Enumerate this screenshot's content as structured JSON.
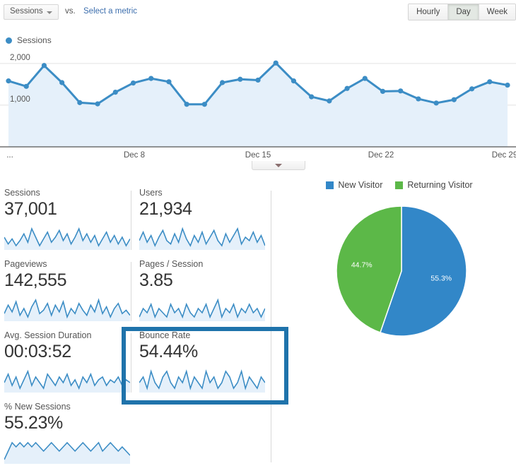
{
  "toolbar": {
    "metric_select_label": "Sessions",
    "vs_label": "vs.",
    "select_metric_link": "Select a metric",
    "caret_icon": "chevron-down-icon",
    "granularity": [
      {
        "label": "Hourly",
        "active": false
      },
      {
        "label": "Day",
        "active": true
      },
      {
        "label": "Week",
        "active": false
      }
    ]
  },
  "chart_legend": {
    "label": "Sessions",
    "color": "#3c8dc5"
  },
  "chart_data": {
    "type": "line",
    "title": "Sessions",
    "xlabel": "",
    "ylabel": "Sessions",
    "ylim": [
      0,
      2200
    ],
    "yticks": [
      1000,
      2000
    ],
    "ytick_labels": [
      "1,000",
      "2,000"
    ],
    "grid": true,
    "legend_position": "top-left",
    "xtick_labels": [
      "...",
      "Dec 8",
      "Dec 15",
      "Dec 22",
      "Dec 29"
    ],
    "series": [
      {
        "name": "Sessions",
        "color": "#3c8dc5",
        "fill": "#e5f0fa",
        "values": [
          1580,
          1450,
          1950,
          1540,
          1060,
          1030,
          1310,
          1530,
          1640,
          1560,
          1020,
          1020,
          1540,
          1620,
          1600,
          2010,
          1580,
          1200,
          1100,
          1400,
          1640,
          1330,
          1340,
          1150,
          1050,
          1130,
          1390,
          1560,
          1480
        ]
      }
    ]
  },
  "collapse_handle": {
    "icon": "triangle-down-icon"
  },
  "metrics": [
    [
      {
        "label": "Sessions",
        "value": "37,001",
        "spark": [
          14,
          10,
          13,
          9,
          12,
          16,
          11,
          19,
          14,
          9,
          13,
          17,
          11,
          14,
          18,
          12,
          16,
          10,
          14,
          19,
          12,
          16,
          11,
          15,
          9,
          13,
          17,
          11,
          15,
          10,
          14,
          9,
          13
        ]
      },
      {
        "label": "Users",
        "value": "21,934",
        "spark": [
          12,
          17,
          11,
          15,
          9,
          14,
          18,
          12,
          10,
          16,
          11,
          19,
          13,
          9,
          15,
          11,
          17,
          10,
          14,
          18,
          12,
          9,
          16,
          11,
          15,
          19,
          10,
          14,
          12,
          17,
          11,
          15,
          9
        ]
      }
    ],
    [
      {
        "label": "Pageviews",
        "value": "142,555",
        "spark": [
          11,
          16,
          12,
          18,
          10,
          14,
          9,
          15,
          19,
          11,
          13,
          17,
          10,
          16,
          12,
          18,
          9,
          14,
          11,
          17,
          13,
          10,
          16,
          12,
          19,
          11,
          15,
          9,
          14,
          17,
          11,
          13,
          10
        ]
      },
      {
        "label": "Pages / Session",
        "value": "3.85",
        "spark": [
          12,
          14,
          13,
          15,
          12,
          14,
          13,
          12,
          15,
          13,
          14,
          12,
          15,
          13,
          12,
          14,
          13,
          15,
          12,
          14,
          16,
          12,
          14,
          13,
          15,
          12,
          14,
          13,
          15,
          13,
          14,
          12,
          14
        ]
      }
    ],
    [
      {
        "label": "Avg. Session Duration",
        "value": "00:03:52",
        "spark": [
          13,
          16,
          12,
          15,
          11,
          14,
          17,
          12,
          15,
          13,
          11,
          16,
          14,
          12,
          15,
          13,
          16,
          12,
          14,
          11,
          15,
          13,
          16,
          12,
          14,
          15,
          12,
          14,
          13,
          15,
          12,
          14,
          13
        ]
      },
      {
        "label": "Bounce Rate",
        "value": "54.44%",
        "highlighted": true,
        "spark": [
          13,
          14,
          12,
          15,
          13,
          12,
          14,
          15,
          13,
          12,
          14,
          13,
          15,
          12,
          14,
          13,
          12,
          15,
          13,
          14,
          12,
          13,
          15,
          14,
          12,
          13,
          15,
          12,
          14,
          13,
          12,
          14,
          13
        ]
      }
    ],
    [
      {
        "label": "% New Sessions",
        "value": "55.23%",
        "spark": [
          11,
          13,
          15,
          14,
          15,
          14,
          15,
          14,
          15,
          14,
          13,
          14,
          15,
          14,
          13,
          14,
          15,
          14,
          13,
          14,
          15,
          14,
          13,
          14,
          15,
          13,
          14,
          15,
          14,
          13,
          14,
          13,
          12
        ]
      }
    ]
  ],
  "pie": {
    "legend": [
      {
        "label": "New Visitor",
        "color": "#3287c8"
      },
      {
        "label": "Returning Visitor",
        "color": "#5cb848"
      }
    ],
    "chart_data": {
      "type": "pie",
      "title": "",
      "labels": [
        "New Visitor",
        "Returning Visitor"
      ],
      "values": [
        55.3,
        44.7
      ],
      "value_labels": [
        "55.3%",
        "44.7%"
      ],
      "colors": [
        "#3287c8",
        "#5cb848"
      ],
      "legend_position": "top"
    }
  },
  "colors": {
    "accent_blue": "#3c8dc5",
    "area_fill": "#e5f0fa",
    "highlight_box": "#1f73ab",
    "pie_blue": "#3287c8",
    "pie_green": "#5cb848"
  }
}
